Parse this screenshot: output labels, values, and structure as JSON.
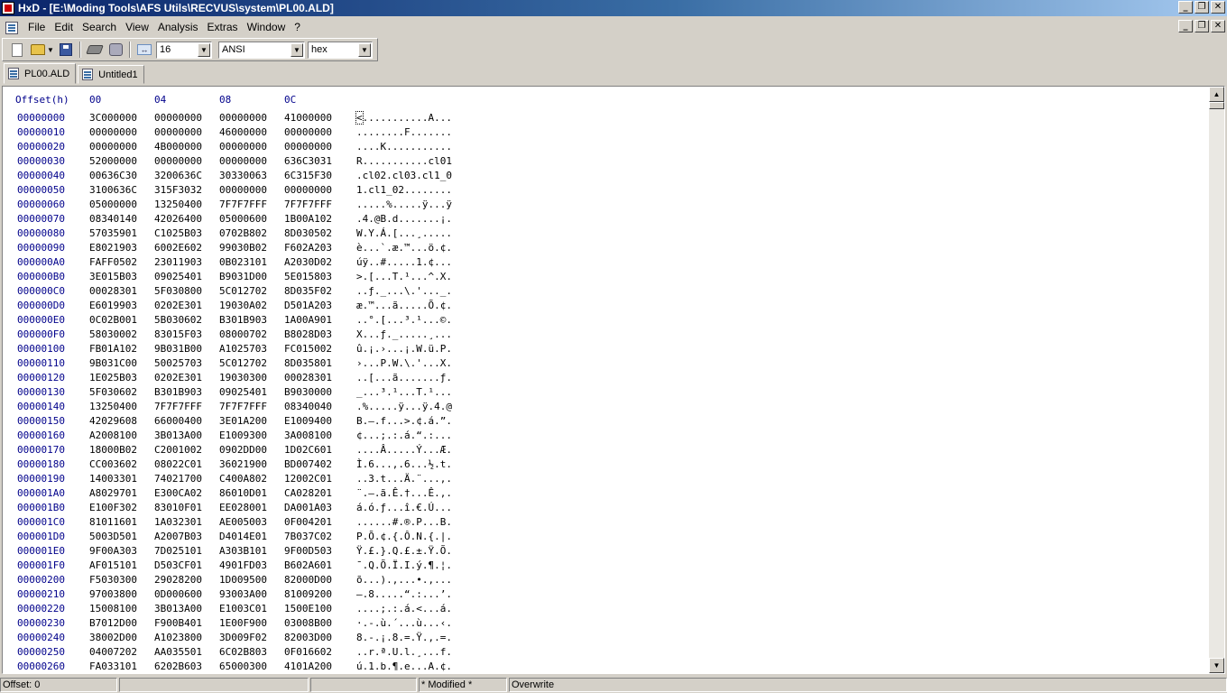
{
  "window": {
    "title": "HxD - [E:\\Moding Tools\\AFS Utils\\RECVUS\\system\\PL00.ALD]"
  },
  "window_buttons": [
    "_",
    "❐",
    "✕"
  ],
  "menu": {
    "items": [
      "File",
      "Edit",
      "Search",
      "View",
      "Analysis",
      "Extras",
      "Window",
      "?"
    ]
  },
  "toolbar": {
    "bytes_per_row": "16",
    "charset": "ANSI",
    "offset_base": "hex"
  },
  "tabs": [
    {
      "label": "PL00.ALD"
    },
    {
      "label": "Untitled1"
    }
  ],
  "hex": {
    "header": {
      "offset": "Offset(h)",
      "cols": [
        "00",
        "04",
        "08",
        "0C"
      ]
    },
    "rows": [
      {
        "off": "00000000",
        "g": [
          "3C000000",
          "00000000",
          "00000000",
          "41000000"
        ],
        "a": "<...........A..."
      },
      {
        "off": "00000010",
        "g": [
          "00000000",
          "00000000",
          "46000000",
          "00000000"
        ],
        "a": "........F......."
      },
      {
        "off": "00000020",
        "g": [
          "00000000",
          "4B000000",
          "00000000",
          "00000000"
        ],
        "a": "....K..........."
      },
      {
        "off": "00000030",
        "g": [
          "52000000",
          "00000000",
          "00000000",
          "636C3031"
        ],
        "a": "R...........cl01"
      },
      {
        "off": "00000040",
        "g": [
          "00636C30",
          "3200636C",
          "30330063",
          "6C315F30"
        ],
        "a": ".cl02.cl03.cl1_0"
      },
      {
        "off": "00000050",
        "g": [
          "3100636C",
          "315F3032",
          "00000000",
          "00000000"
        ],
        "a": "1.cl1_02........"
      },
      {
        "off": "00000060",
        "g": [
          "05000000",
          "13250400",
          "7F7F7FFF",
          "7F7F7FFF"
        ],
        "a": ".....%.....ÿ...ÿ"
      },
      {
        "off": "00000070",
        "g": [
          "08340140",
          "42026400",
          "05000600",
          "1B00A102"
        ],
        "a": ".4.@B.d.......¡."
      },
      {
        "off": "00000080",
        "g": [
          "57035901",
          "C1025B03",
          "0702B802",
          "8D030502"
        ],
        "a": "W.Y.Á.[...¸....."
      },
      {
        "off": "00000090",
        "g": [
          "E8021903",
          "6002E602",
          "99030B02",
          "F602A203"
        ],
        "a": "è...`.æ.™...ö.¢."
      },
      {
        "off": "000000A0",
        "g": [
          "FAFF0502",
          "23011903",
          "0B023101",
          "A2030D02"
        ],
        "a": "úÿ..#.....1.¢..."
      },
      {
        "off": "000000B0",
        "g": [
          "3E015B03",
          "09025401",
          "B9031D00",
          "5E015803"
        ],
        "a": ">.[...T.¹...^.X."
      },
      {
        "off": "000000C0",
        "g": [
          "00028301",
          "5F030800",
          "5C012702",
          "8D035F02"
        ],
        "a": "..ƒ._...\\.'..._."
      },
      {
        "off": "000000D0",
        "g": [
          "E6019903",
          "0202E301",
          "19030A02",
          "D501A203"
        ],
        "a": "æ.™...ã.....Õ.¢."
      },
      {
        "off": "000000E0",
        "g": [
          "0C02B001",
          "5B030602",
          "B301B903",
          "1A00A901"
        ],
        "a": "..°.[...³.¹...©."
      },
      {
        "off": "000000F0",
        "g": [
          "58030002",
          "83015F03",
          "08000702",
          "B8028D03"
        ],
        "a": "X...ƒ._.....¸..."
      },
      {
        "off": "00000100",
        "g": [
          "FB01A102",
          "9B031B00",
          "A1025703",
          "FC015002"
        ],
        "a": "û.¡.›...¡.W.ü.P."
      },
      {
        "off": "00000110",
        "g": [
          "9B031C00",
          "50025703",
          "5C012702",
          "8D035801"
        ],
        "a": "›...P.W.\\.'...X."
      },
      {
        "off": "00000120",
        "g": [
          "1E025B03",
          "0202E301",
          "19030300",
          "00028301"
        ],
        "a": "..[...ã.......ƒ."
      },
      {
        "off": "00000130",
        "g": [
          "5F030602",
          "B301B903",
          "09025401",
          "B9030000"
        ],
        "a": "_...³.¹...T.¹..."
      },
      {
        "off": "00000140",
        "g": [
          "13250400",
          "7F7F7FFF",
          "7F7F7FFF",
          "08340040"
        ],
        "a": ".%.....ÿ...ÿ.4.@"
      },
      {
        "off": "00000150",
        "g": [
          "42029608",
          "66000400",
          "3E01A200",
          "E1009400"
        ],
        "a": "B.–.f...>.¢.á.”."
      },
      {
        "off": "00000160",
        "g": [
          "A2008100",
          "3B013A00",
          "E1009300",
          "3A008100"
        ],
        "a": "¢...;.:.á.“.:..."
      },
      {
        "off": "00000170",
        "g": [
          "18000B02",
          "C2001002",
          "0902DD00",
          "1D02C601"
        ],
        "a": "....Â.....Ý...Æ."
      },
      {
        "off": "00000180",
        "g": [
          "CC003602",
          "08022C01",
          "36021900",
          "BD007402"
        ],
        "a": "Ì.6...,.6...½.t."
      },
      {
        "off": "00000190",
        "g": [
          "14003301",
          "74021700",
          "C400A802",
          "12002C01"
        ],
        "a": "..3.t...Ä.¨...,."
      },
      {
        "off": "000001A0",
        "g": [
          "A8029701",
          "E300CA02",
          "86010D01",
          "CA028201"
        ],
        "a": "¨.—.ã.Ê.†...Ê.‚."
      },
      {
        "off": "000001B0",
        "g": [
          "E100F302",
          "83010F01",
          "EE028001",
          "DA001A03"
        ],
        "a": "á.ó.ƒ...î.€.Ú..."
      },
      {
        "off": "000001C0",
        "g": [
          "81011601",
          "1A032301",
          "AE005003",
          "0F004201"
        ],
        "a": "......#.®.P...B."
      },
      {
        "off": "000001D0",
        "g": [
          "5003D501",
          "A2007B03",
          "D4014E01",
          "7B037C02"
        ],
        "a": "P.Õ.¢.{.Ô.N.{.|."
      },
      {
        "off": "000001E0",
        "g": [
          "9F00A303",
          "7D025101",
          "A303B101",
          "9F00D503"
        ],
        "a": "Ÿ.£.}.Q.£.±.Ÿ.Õ."
      },
      {
        "off": "000001F0",
        "g": [
          "AF015101",
          "D503CF01",
          "4901FD03",
          "B602A601"
        ],
        "a": "¯.Q.Õ.Ï.I.ý.¶.¦."
      },
      {
        "off": "00000200",
        "g": [
          "F5030300",
          "29028200",
          "1D009500",
          "82000D00"
        ],
        "a": "õ...).‚...•.‚..."
      },
      {
        "off": "00000210",
        "g": [
          "97003800",
          "0D000600",
          "93003A00",
          "81009200"
        ],
        "a": "—.8.....“.:...’."
      },
      {
        "off": "00000220",
        "g": [
          "15008100",
          "3B013A00",
          "E1003C01",
          "1500E100"
        ],
        "a": "....;.:.á.<...á."
      },
      {
        "off": "00000230",
        "g": [
          "B7012D00",
          "F900B401",
          "1E00F900",
          "03008B00"
        ],
        "a": "·.-.ù.´...ù...‹."
      },
      {
        "off": "00000240",
        "g": [
          "38002D00",
          "A1023800",
          "3D009F02",
          "82003D00"
        ],
        "a": "8.-.¡.8.=.Ÿ.‚.=."
      },
      {
        "off": "00000250",
        "g": [
          "04007202",
          "AA035501",
          "6C02B803",
          "0F016602"
        ],
        "a": "..r.ª.U.l.¸...f."
      },
      {
        "off": "00000260",
        "g": [
          "FA033101",
          "6202B603",
          "65000300",
          "4101A200"
        ],
        "a": "ú.1.b.¶.e...A.¢."
      }
    ]
  },
  "status": {
    "offset": "Offset: 0",
    "modified": "* Modified *",
    "mode": "Overwrite"
  }
}
